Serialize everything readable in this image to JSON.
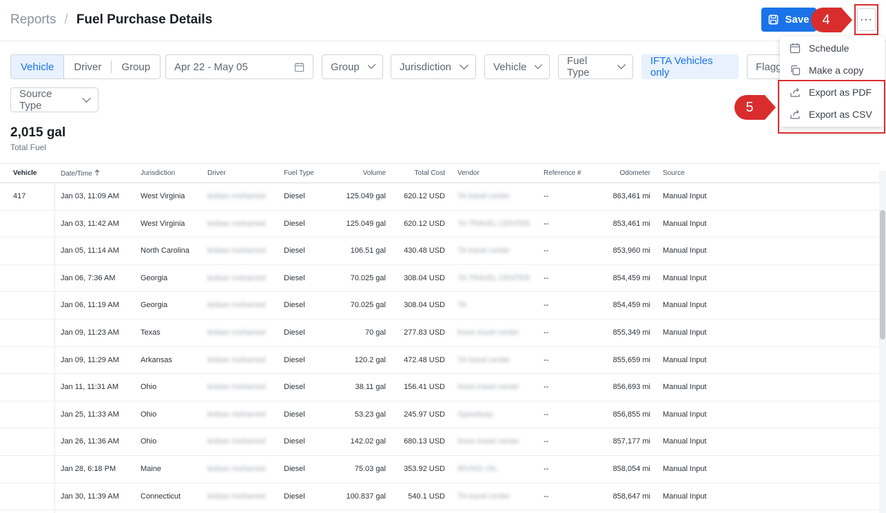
{
  "header": {
    "breadcrumb_parent": "Reports",
    "breadcrumb_sep": "/",
    "title": "Fuel Purchase Details",
    "save_label": "Save",
    "more_label": "···"
  },
  "annotations": {
    "badge_4": "4",
    "badge_5": "5",
    "color": "#d92d2d"
  },
  "filters": {
    "segments": [
      "Vehicle",
      "Driver",
      "Group"
    ],
    "date_range": "Apr 22 - May 05",
    "dropdowns": [
      "Group",
      "Jurisdiction",
      "Vehicle",
      "Fuel Type"
    ],
    "ifta_toggle": "IFTA Vehicles only",
    "flagged": "Flagg",
    "source_type": "Source Type"
  },
  "summary": {
    "value": "2,015 gal",
    "label": "Total Fuel"
  },
  "menu": {
    "schedule": "Schedule",
    "make_copy": "Make a copy",
    "export_pdf": "Export as PDF",
    "export_csv": "Export as CSV"
  },
  "table": {
    "headers": {
      "vehicle": "Vehicle",
      "datetime": "Date/Time",
      "jurisdiction": "Jurisdiction",
      "driver": "Driver",
      "fuel_type": "Fuel Type",
      "volume": "Volume",
      "total_cost": "Total Cost",
      "vendor": "Vendor",
      "reference": "Reference #",
      "odometer": "Odometer",
      "source": "Source"
    },
    "vehicle_id": "417",
    "rows": [
      {
        "datetime": "Jan 03, 11:09 AM",
        "jurisdiction": "West Virginia",
        "driver": "lesban mohamed",
        "fuel": "Diesel",
        "volume": "125.049 gal",
        "cost": "620.12 USD",
        "vendor": "TA travel center",
        "ref": "--",
        "odometer": "863,461 mi",
        "source": "Manual Input"
      },
      {
        "datetime": "Jan 03, 11:42 AM",
        "jurisdiction": "West Virginia",
        "driver": "lesban mohamed",
        "fuel": "Diesel",
        "volume": "125.049 gal",
        "cost": "620.12 USD",
        "vendor": "TA TRAVEL CENTER",
        "ref": "--",
        "odometer": "853,461 mi",
        "source": "Manual Input"
      },
      {
        "datetime": "Jan 05, 11:14 AM",
        "jurisdiction": "North Carolina",
        "driver": "lesban mohamed",
        "fuel": "Diesel",
        "volume": "106.51 gal",
        "cost": "430.48 USD",
        "vendor": "TA travel center",
        "ref": "--",
        "odometer": "853,960 mi",
        "source": "Manual Input"
      },
      {
        "datetime": "Jan 06, 7:36 AM",
        "jurisdiction": "Georgia",
        "driver": "lesban mohamed",
        "fuel": "Diesel",
        "volume": "70.025 gal",
        "cost": "308.04 USD",
        "vendor": "TA TRAVEL CENTER",
        "ref": "--",
        "odometer": "854,459 mi",
        "source": "Manual Input"
      },
      {
        "datetime": "Jan 06, 11:19 AM",
        "jurisdiction": "Georgia",
        "driver": "lesban mohamed",
        "fuel": "Diesel",
        "volume": "70.025 gal",
        "cost": "308.04 USD",
        "vendor": "TA",
        "ref": "--",
        "odometer": "854,459 mi",
        "source": "Manual Input"
      },
      {
        "datetime": "Jan 09, 11:23 AM",
        "jurisdiction": "Texas",
        "driver": "lesban mohamed",
        "fuel": "Diesel",
        "volume": "70 gal",
        "cost": "277.83 USD",
        "vendor": "loves travel center",
        "ref": "--",
        "odometer": "855,349 mi",
        "source": "Manual Input"
      },
      {
        "datetime": "Jan 09, 11:29 AM",
        "jurisdiction": "Arkansas",
        "driver": "lesban mohamed",
        "fuel": "Diesel",
        "volume": "120.2 gal",
        "cost": "472.48 USD",
        "vendor": "TA travel center",
        "ref": "--",
        "odometer": "855,659 mi",
        "source": "Manual Input"
      },
      {
        "datetime": "Jan 11, 11:31 AM",
        "jurisdiction": "Ohio",
        "driver": "lesban mohamed",
        "fuel": "Diesel",
        "volume": "38.11 gal",
        "cost": "156.41 USD",
        "vendor": "loves travel center",
        "ref": "--",
        "odometer": "856,693 mi",
        "source": "Manual Input"
      },
      {
        "datetime": "Jan 25, 11:33 AM",
        "jurisdiction": "Ohio",
        "driver": "lesban mohamed",
        "fuel": "Diesel",
        "volume": "53.23 gal",
        "cost": "245.97 USD",
        "vendor": "Speedway",
        "ref": "--",
        "odometer": "856,855 mi",
        "source": "Manual Input"
      },
      {
        "datetime": "Jan 26, 11:36 AM",
        "jurisdiction": "Ohio",
        "driver": "lesban mohamed",
        "fuel": "Diesel",
        "volume": "142.02 gal",
        "cost": "680.13 USD",
        "vendor": "loves travel center",
        "ref": "--",
        "odometer": "857,177 mi",
        "source": "Manual Input"
      },
      {
        "datetime": "Jan 28, 6:18 PM",
        "jurisdiction": "Maine",
        "driver": "lesban mohamed",
        "fuel": "Diesel",
        "volume": "75.03 gal",
        "cost": "353.92 USD",
        "vendor": "IRVING OIL",
        "ref": "--",
        "odometer": "858,054 mi",
        "source": "Manual Input"
      },
      {
        "datetime": "Jan 30, 11:39 AM",
        "jurisdiction": "Connecticut",
        "driver": "lesban mohamed",
        "fuel": "Diesel",
        "volume": "100.837 gal",
        "cost": "540.1 USD",
        "vendor": "TA travel center",
        "ref": "--",
        "odometer": "858,647 mi",
        "source": "Manual Input"
      }
    ]
  }
}
